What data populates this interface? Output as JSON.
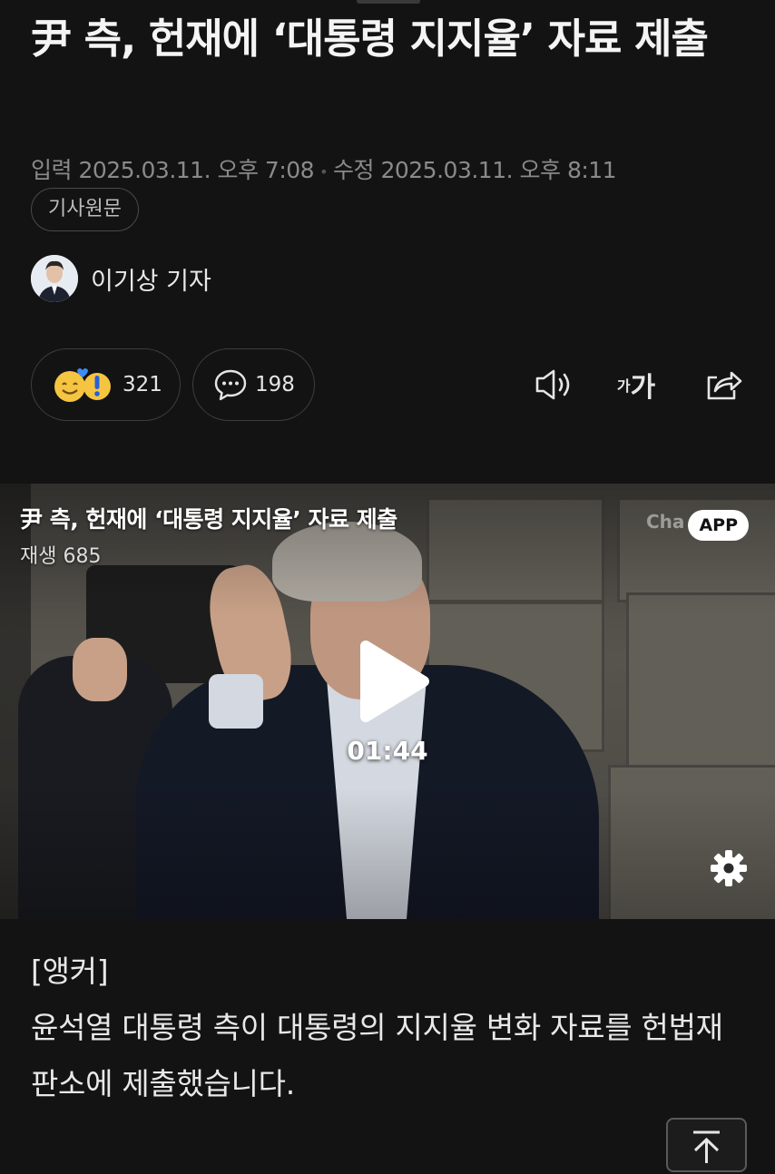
{
  "article": {
    "title": "尹 측, 헌재에 ‘대통령 지지율’ 자료 제출",
    "published": "입력 2025.03.11. 오후 7:08",
    "modified": "수정 2025.03.11. 오후 8:11",
    "source_button": "기사원문",
    "reporter": "이기상 기자"
  },
  "actions": {
    "reaction_count": "321",
    "comment_count": "198",
    "font_small": "가",
    "font_big": "가"
  },
  "video": {
    "title": "尹 측, 헌재에 ‘대통령 지지율’ 자료 제출",
    "views": "재생 685",
    "app_badge": "APP",
    "channel_logo": "Cha",
    "duration": "01:44"
  },
  "body": {
    "heading": "[앵커]",
    "paragraph": "윤석열 대통령 측이 대통령의 지지율 변화 자료를 헌법재판소에 제출했습니다."
  },
  "icons": {
    "speaker": "speaker-icon",
    "font_size": "font-size-icon",
    "share": "share-icon",
    "comment": "comment-icon",
    "play": "play-icon",
    "settings": "gear-icon",
    "scroll_top": "arrow-up-icon"
  }
}
